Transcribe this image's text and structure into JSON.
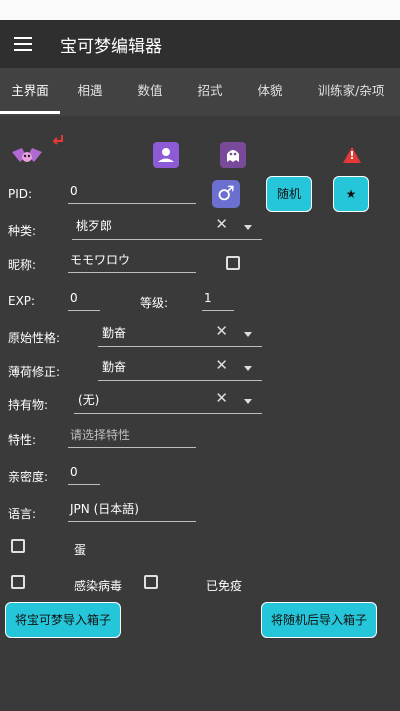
{
  "app": {
    "title": "宝可梦编辑器"
  },
  "tabs": [
    {
      "label": "主界面"
    },
    {
      "label": "相遇"
    },
    {
      "label": "数值"
    },
    {
      "label": "招式"
    },
    {
      "label": "体貌"
    },
    {
      "label": "训练家/杂项"
    }
  ],
  "form": {
    "pid": {
      "label": "PID:",
      "value": "0"
    },
    "species": {
      "label": "种类:",
      "value": "桃歹郎"
    },
    "nickname": {
      "label": "昵称:",
      "value": "モモワロウ"
    },
    "exp": {
      "label": "EXP:",
      "value": "0"
    },
    "level": {
      "label": "等级:",
      "value": "1"
    },
    "nature": {
      "label": "原始性格:",
      "value": "勤奋"
    },
    "mint": {
      "label": "薄荷修正:",
      "value": "勤奋"
    },
    "held_item": {
      "label": "持有物:",
      "value": "(无)"
    },
    "ability": {
      "label": "特性:",
      "placeholder": "请选择特性"
    },
    "friendship": {
      "label": "亲密度:",
      "value": "0"
    },
    "language": {
      "label": "语言:",
      "value": "JPN (日本語)"
    },
    "egg": {
      "label": "蛋"
    },
    "pokerus": {
      "label": "感染病毒"
    },
    "immune": {
      "label": "已免疫"
    }
  },
  "buttons": {
    "random": "随机",
    "star": "★",
    "import_box": "将宝可梦导入箱子",
    "import_box_random": "将随机后导入箱子"
  },
  "glyphs": {
    "clear": "✕",
    "male": "♂",
    "warning": "!"
  },
  "colors": {
    "accent": "#26c6da",
    "background": "#3a3a3a",
    "appbar": "#2f2f2f"
  }
}
